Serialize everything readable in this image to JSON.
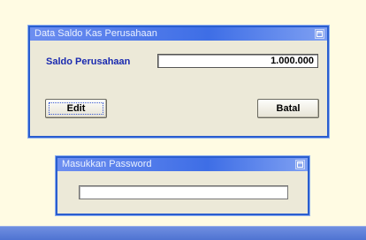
{
  "main_window": {
    "title": "Data Saldo Kas Perusahaan",
    "saldo_label": "Saldo Perusahaan",
    "saldo_value": "1.000.000",
    "edit_button": "Edit",
    "batal_button": "Batal"
  },
  "password_window": {
    "title": "Masukkan Password",
    "password_value": ""
  },
  "icons": {
    "window_button": "window-control-icon"
  },
  "colors": {
    "titlebar": "#3e6ee6",
    "window_border": "#2a5ecf",
    "window_body": "#ece9d8",
    "background": "#fffbe3",
    "label_text": "#1a2ab0",
    "taskbar": "#4f73d2"
  }
}
